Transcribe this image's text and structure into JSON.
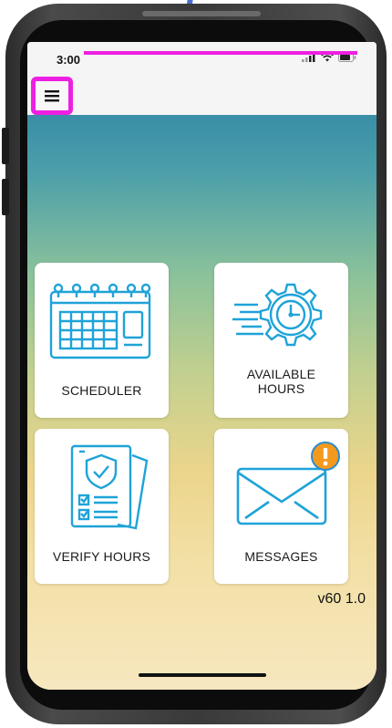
{
  "status_bar": {
    "time": "3:00",
    "icons": [
      "cellular-signal-icon",
      "wifi-icon",
      "battery-icon"
    ]
  },
  "app_bar": {
    "menu_icon": "hamburger-menu-icon"
  },
  "tiles": [
    {
      "label": "SCHEDULER",
      "icon": "calendar-icon"
    },
    {
      "label": "AVAILABLE HOURS",
      "icon": "clock-gear-icon"
    },
    {
      "label": "VERIFY HOURS",
      "icon": "checklist-shield-icon"
    },
    {
      "label": "MESSAGES",
      "icon": "envelope-alert-icon"
    }
  ],
  "version": "v60 1.0",
  "colors": {
    "icon_blue": "#1fa3d8",
    "annotation_magenta": "#ee1fe2",
    "annotation_blue": "#4d6fd0",
    "alert_orange": "#f39a1e"
  }
}
